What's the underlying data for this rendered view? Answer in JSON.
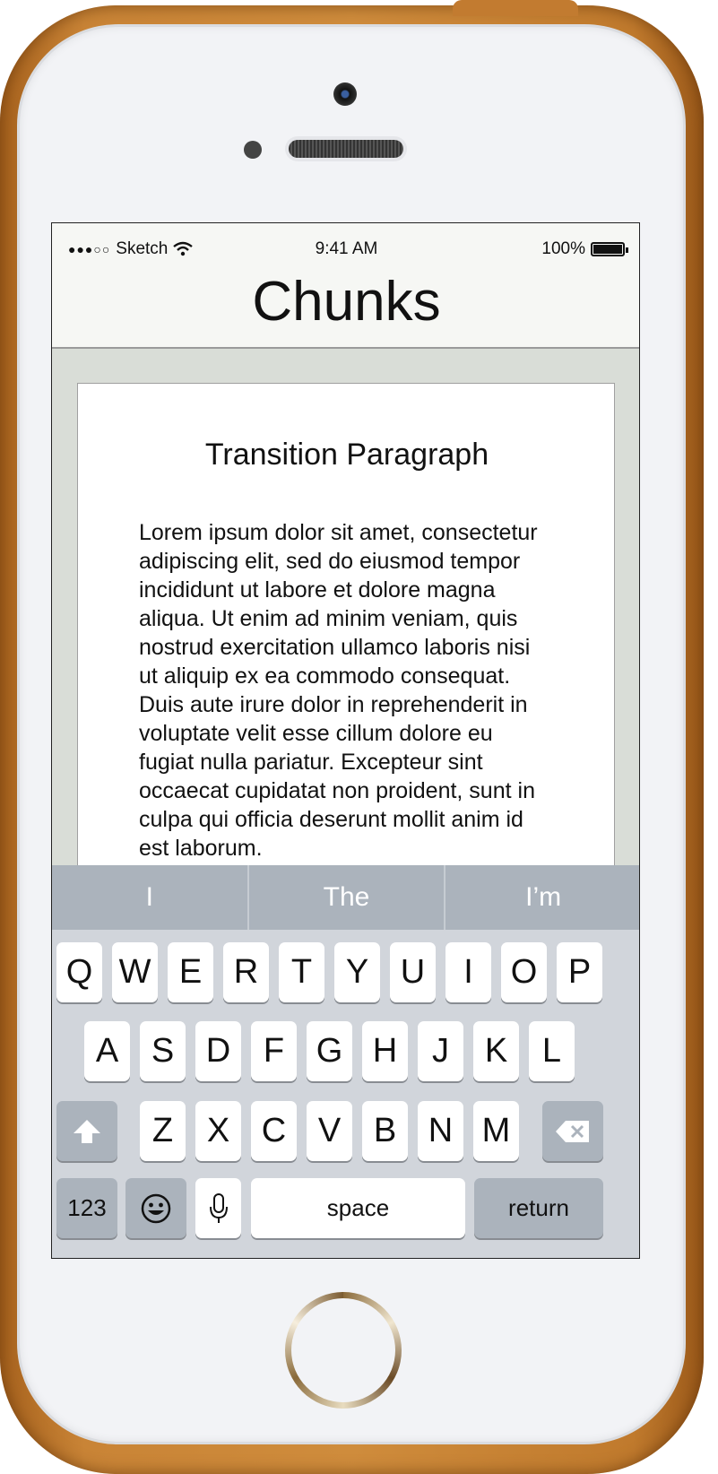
{
  "status_bar": {
    "carrier": "Sketch",
    "signal": "●●●○○",
    "time": "9:41 AM",
    "battery": "100%"
  },
  "nav": {
    "title": "Chunks"
  },
  "card": {
    "title": "Transition Paragraph",
    "body": "Lorem ipsum dolor sit amet, consectetur adipiscing elit, sed do eiusmod tempor incididunt ut labore et dolore magna aliqua. Ut enim ad minim veniam, quis nostrud exercitation ullamco laboris nisi ut aliquip ex ea commodo consequat. Duis aute irure dolor in reprehenderit in voluptate velit esse cillum dolore eu fugiat nulla pariatur. Excepteur sint occaecat cupidatat non proident, sunt in culpa qui officia deserunt mollit anim id est laborum."
  },
  "keyboard": {
    "suggestions": [
      "I",
      "The",
      "I’m"
    ],
    "row1": [
      "Q",
      "W",
      "E",
      "R",
      "T",
      "Y",
      "U",
      "I",
      "O",
      "P"
    ],
    "row2": [
      "A",
      "S",
      "D",
      "F",
      "G",
      "H",
      "J",
      "K",
      "L"
    ],
    "row3": [
      "Z",
      "X",
      "C",
      "V",
      "B",
      "N",
      "M"
    ],
    "numbers_label": "123",
    "space_label": "space",
    "return_label": "return"
  },
  "colors": {
    "case": "#c98436",
    "keyboard_bg": "#d1d5db",
    "suggestion_bar": "#abb3bc",
    "screen_bg": "#d9ddd7"
  },
  "icons": [
    "wifi-icon",
    "battery-icon",
    "shift-icon",
    "backspace-icon",
    "emoji-icon",
    "microphone-icon",
    "home-button"
  ]
}
